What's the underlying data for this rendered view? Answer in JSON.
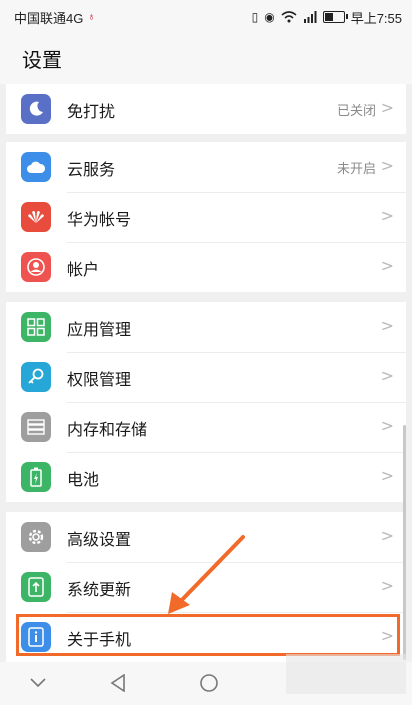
{
  "status_bar": {
    "carrier": "中国联通4G",
    "time": "早上7:55",
    "icons": [
      "vibrate-icon",
      "eye-icon",
      "wifi-icon",
      "signal-icon",
      "battery-icon"
    ]
  },
  "header": {
    "title": "设置"
  },
  "groups": [
    {
      "items": [
        {
          "label": "免打扰",
          "value": "已关闭",
          "icon": "moon-icon",
          "color": "#5a6fc6"
        }
      ]
    },
    {
      "items": [
        {
          "label": "云服务",
          "value": "未开启",
          "icon": "cloud-icon",
          "color": "#3c8ee8"
        },
        {
          "label": "华为帐号",
          "value": "",
          "icon": "huawei-icon",
          "color": "#e84c3d"
        },
        {
          "label": "帐户",
          "value": "",
          "icon": "account-icon",
          "color": "#ef5350"
        }
      ]
    },
    {
      "items": [
        {
          "label": "应用管理",
          "value": "",
          "icon": "apps-icon",
          "color": "#3db567"
        },
        {
          "label": "权限管理",
          "value": "",
          "icon": "key-icon",
          "color": "#27a7d8"
        },
        {
          "label": "内存和存储",
          "value": "",
          "icon": "storage-icon",
          "color": "#9e9e9e"
        },
        {
          "label": "电池",
          "value": "",
          "icon": "battery-icon",
          "color": "#3db567"
        }
      ]
    },
    {
      "items": [
        {
          "label": "高级设置",
          "value": "",
          "icon": "gear-icon",
          "color": "#9e9e9e"
        },
        {
          "label": "系统更新",
          "value": "",
          "icon": "update-icon",
          "color": "#3db567"
        },
        {
          "label": "关于手机",
          "value": "",
          "icon": "info-icon",
          "color": "#3c8ee8"
        }
      ]
    }
  ],
  "navbar": {
    "buttons": [
      "collapse-icon",
      "back-icon",
      "home-icon"
    ]
  },
  "accent": {
    "highlight": "#f26a2a"
  }
}
